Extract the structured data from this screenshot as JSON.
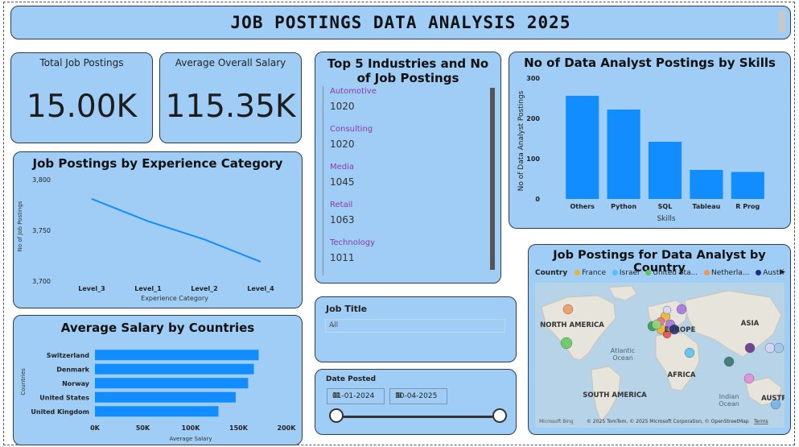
{
  "title": "JOB POSTINGS DATA ANALYSIS 2025",
  "kpis": [
    {
      "label": "Total Job Postings",
      "value": "15.00K"
    },
    {
      "label": "Average Overall Salary",
      "value": "115.35K"
    }
  ],
  "industries": {
    "title": "Top 5 Industries and No of Job Postings",
    "items": [
      {
        "name": "Automotive",
        "value": "1020"
      },
      {
        "name": "Consulting",
        "value": "1020"
      },
      {
        "name": "Media",
        "value": "1045"
      },
      {
        "name": "Retail",
        "value": "1063"
      },
      {
        "name": "Technology",
        "value": "1011"
      }
    ]
  },
  "skills_chart": {
    "title": "No of Data Analyst Postings by Skills",
    "ylabel": "No of Data Analyst Postings",
    "xlabel": "Skills"
  },
  "experience_chart": {
    "title": "Job Postings by Experience Category",
    "ylabel": "No of Job Postings",
    "xlabel": "Experience Category"
  },
  "salary_chart": {
    "title": "Average Salary by Countries",
    "ylabel": "Countries",
    "xlabel": "Average Salary"
  },
  "job_title_slicer": {
    "label": "Job Title",
    "selected": "All"
  },
  "date_slicer": {
    "label": "Date Posted",
    "start": "01-01-2024",
    "end": "30-04-2025"
  },
  "map": {
    "title": "Job Postings for Data Analyst by Country",
    "legend_label": "Country",
    "legend": [
      {
        "name": "France",
        "color": "#f2b12d"
      },
      {
        "name": "Israel",
        "color": "#4fc3f7"
      },
      {
        "name": "United Sta...",
        "color": "#5cc85c"
      },
      {
        "name": "Netherla...",
        "color": "#f0955a"
      },
      {
        "name": "Austria",
        "color": "#1f2a8a"
      }
    ],
    "labels": [
      "NORTH AMERICA",
      "EUROPE",
      "ASIA",
      "Atlantic",
      "Ocean",
      "AFRICA",
      "SOUTH AMERICA",
      "Indian",
      "Ocean",
      "AUSTR"
    ],
    "copyright": "© 2025 TomTom, © 2025 Microsoft Corporation, © OpenStreetMap",
    "terms": "Terms",
    "bing": "Microsoft Bing"
  },
  "chart_data": [
    {
      "type": "bar",
      "title": "No of Data Analyst Postings by Skills",
      "categories": [
        "Others",
        "Python",
        "SQL",
        "Tableau",
        "R Prog"
      ],
      "values": [
        256,
        222,
        142,
        72,
        67
      ],
      "ylim": [
        0,
        300
      ],
      "yticks": [
        "300",
        "200",
        "100",
        "0"
      ],
      "xlabel": "Skills",
      "ylabel": "No of Data Analyst Postings",
      "color": "#118dff"
    },
    {
      "type": "line",
      "title": "Job Postings by Experience Category",
      "categories": [
        "Level_3",
        "Level_1",
        "Level_2",
        "Level_4"
      ],
      "values": [
        3781,
        3759,
        3741,
        3719
      ],
      "ylim": [
        3700,
        3800
      ],
      "yticks": [
        "3,800",
        "3,750",
        "3,700"
      ],
      "xlabel": "Experience Category",
      "ylabel": "No of Job Postings",
      "color": "#118dff"
    },
    {
      "type": "bar",
      "orientation": "horizontal",
      "title": "Average Salary by Countries",
      "categories": [
        "Switzerland",
        "Denmark",
        "Norway",
        "United States",
        "United Kingdom"
      ],
      "values": [
        171000,
        166000,
        160000,
        147000,
        129000
      ],
      "xlim": [
        0,
        200000
      ],
      "xticks": [
        "0K",
        "50K",
        "100K",
        "150K",
        "200K"
      ],
      "xlabel": "Average Salary",
      "ylabel": "Countries",
      "color": "#118dff"
    }
  ]
}
